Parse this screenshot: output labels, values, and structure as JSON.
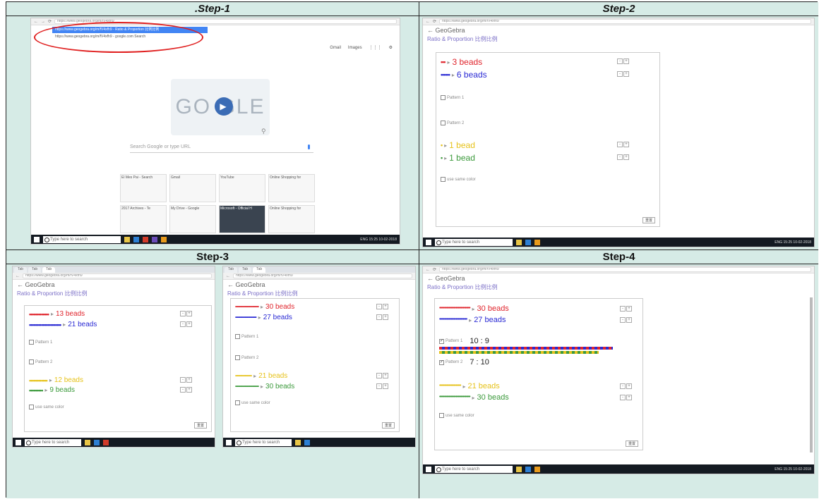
{
  "steps": [
    {
      "title": ".Step-1"
    },
    {
      "title": "Step-2"
    },
    {
      "title": "Step-3"
    },
    {
      "title": "Step-4"
    }
  ],
  "browser": {
    "url": "https://www.geogebra.org/m/fV4xfh9",
    "suggestion_1": "https://www.geogebra.org/m/fV4xfh9 - Ratio & Proportion 比例比例",
    "suggestion_2": "https://www.geogebra.org/m/fV4xfh9 - google.com Search",
    "gmail": "Gmail",
    "images": "Images",
    "google_logo": "GO  GLE",
    "search_placeholder": "Search Google or type URL",
    "tiles": [
      "El Mes Pai - Search",
      "Gmail",
      "YouTube",
      "Online Shopping for",
      "2017 Archives - Te",
      "My Drive - Google",
      "Microsoft - Official H",
      "Online Shopping for"
    ]
  },
  "taskbar": {
    "search": "Type here to search",
    "tray": "ENG 15:25 10-02-2018"
  },
  "geogebra": {
    "back": "← GeoGebra",
    "title": "Ratio & Proportion 比例比例",
    "pattern1": "Pattern 1",
    "pattern2": "Pattern 2",
    "use_same": "use same color",
    "reset": "重置"
  },
  "step2": {
    "r1": "3 beads",
    "r2": "6 beads",
    "r3": "1 bead",
    "r4": "1 bead"
  },
  "step3a": {
    "r1": "13 beads",
    "r2": "21 beads",
    "r3": "12 beads",
    "r4": "9 beads"
  },
  "step3b": {
    "r1": "30 beads",
    "r2": "27 beads",
    "r3": "21 beads",
    "r4": "30 beads"
  },
  "step4": {
    "r1": "30 beads",
    "r2": "27 beads",
    "ratio1": "10 : 9",
    "ratio2": "7 : 10",
    "r3": "21 beads",
    "r4": "30 beads"
  },
  "colors": {
    "red": "#e0252d",
    "blue": "#2a2ad4",
    "yellow": "#e6c21a",
    "green": "#3c9a3c",
    "highlight": "#e02020",
    "cell_bg": "#d6ebe6"
  }
}
